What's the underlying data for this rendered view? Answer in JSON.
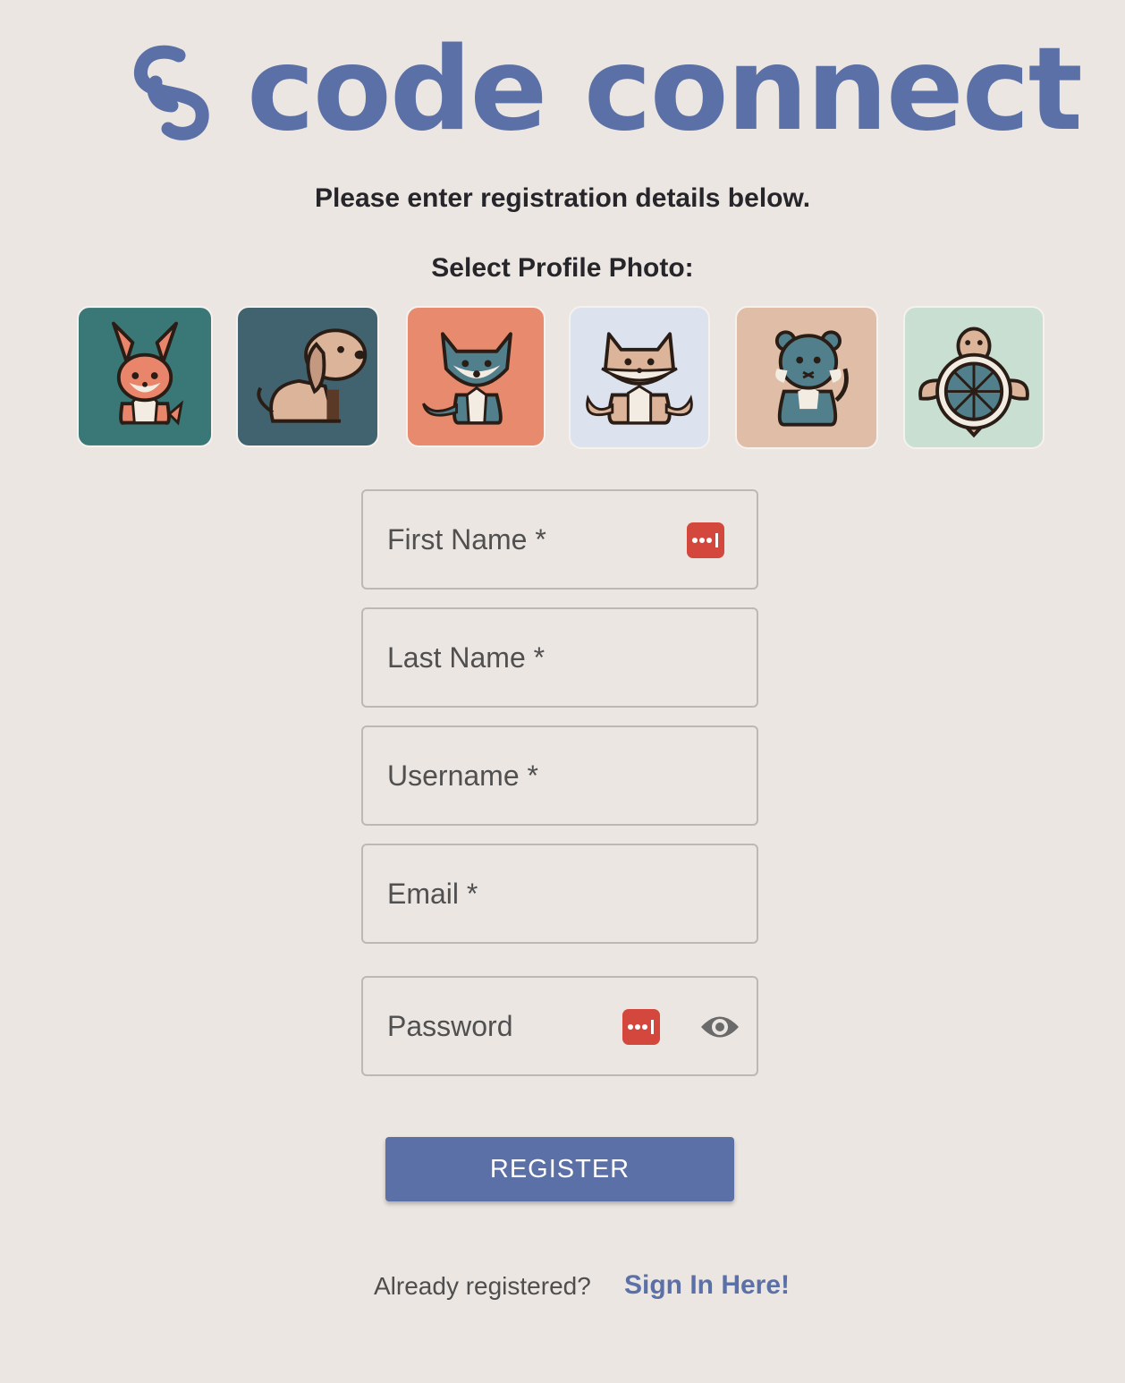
{
  "brand": {
    "name": "code connect",
    "color": "#5a70a6"
  },
  "headings": {
    "instructions": "Please enter registration details below.",
    "profile_photo": "Select Profile Photo:"
  },
  "avatars": [
    {
      "animal": "rabbit",
      "background": "#3a7878"
    },
    {
      "animal": "dog",
      "background": "#41636f"
    },
    {
      "animal": "wolf",
      "background": "#e78a6d"
    },
    {
      "animal": "fox",
      "background": "#dde3ee"
    },
    {
      "animal": "bear",
      "background": "#dfbda6"
    },
    {
      "animal": "turtle",
      "background": "#c8dfd2"
    }
  ],
  "form": {
    "first_name": {
      "label": "First Name *",
      "icon": "password-manager-icon"
    },
    "last_name": {
      "label": "Last Name *"
    },
    "username": {
      "label": "Username *"
    },
    "email": {
      "label": "Email *"
    },
    "password": {
      "label": "Password",
      "icons": [
        "password-manager-icon",
        "eye-icon"
      ]
    },
    "register_label": "REGISTER"
  },
  "footer": {
    "prompt": "Already registered?",
    "link": "Sign In Here!"
  }
}
